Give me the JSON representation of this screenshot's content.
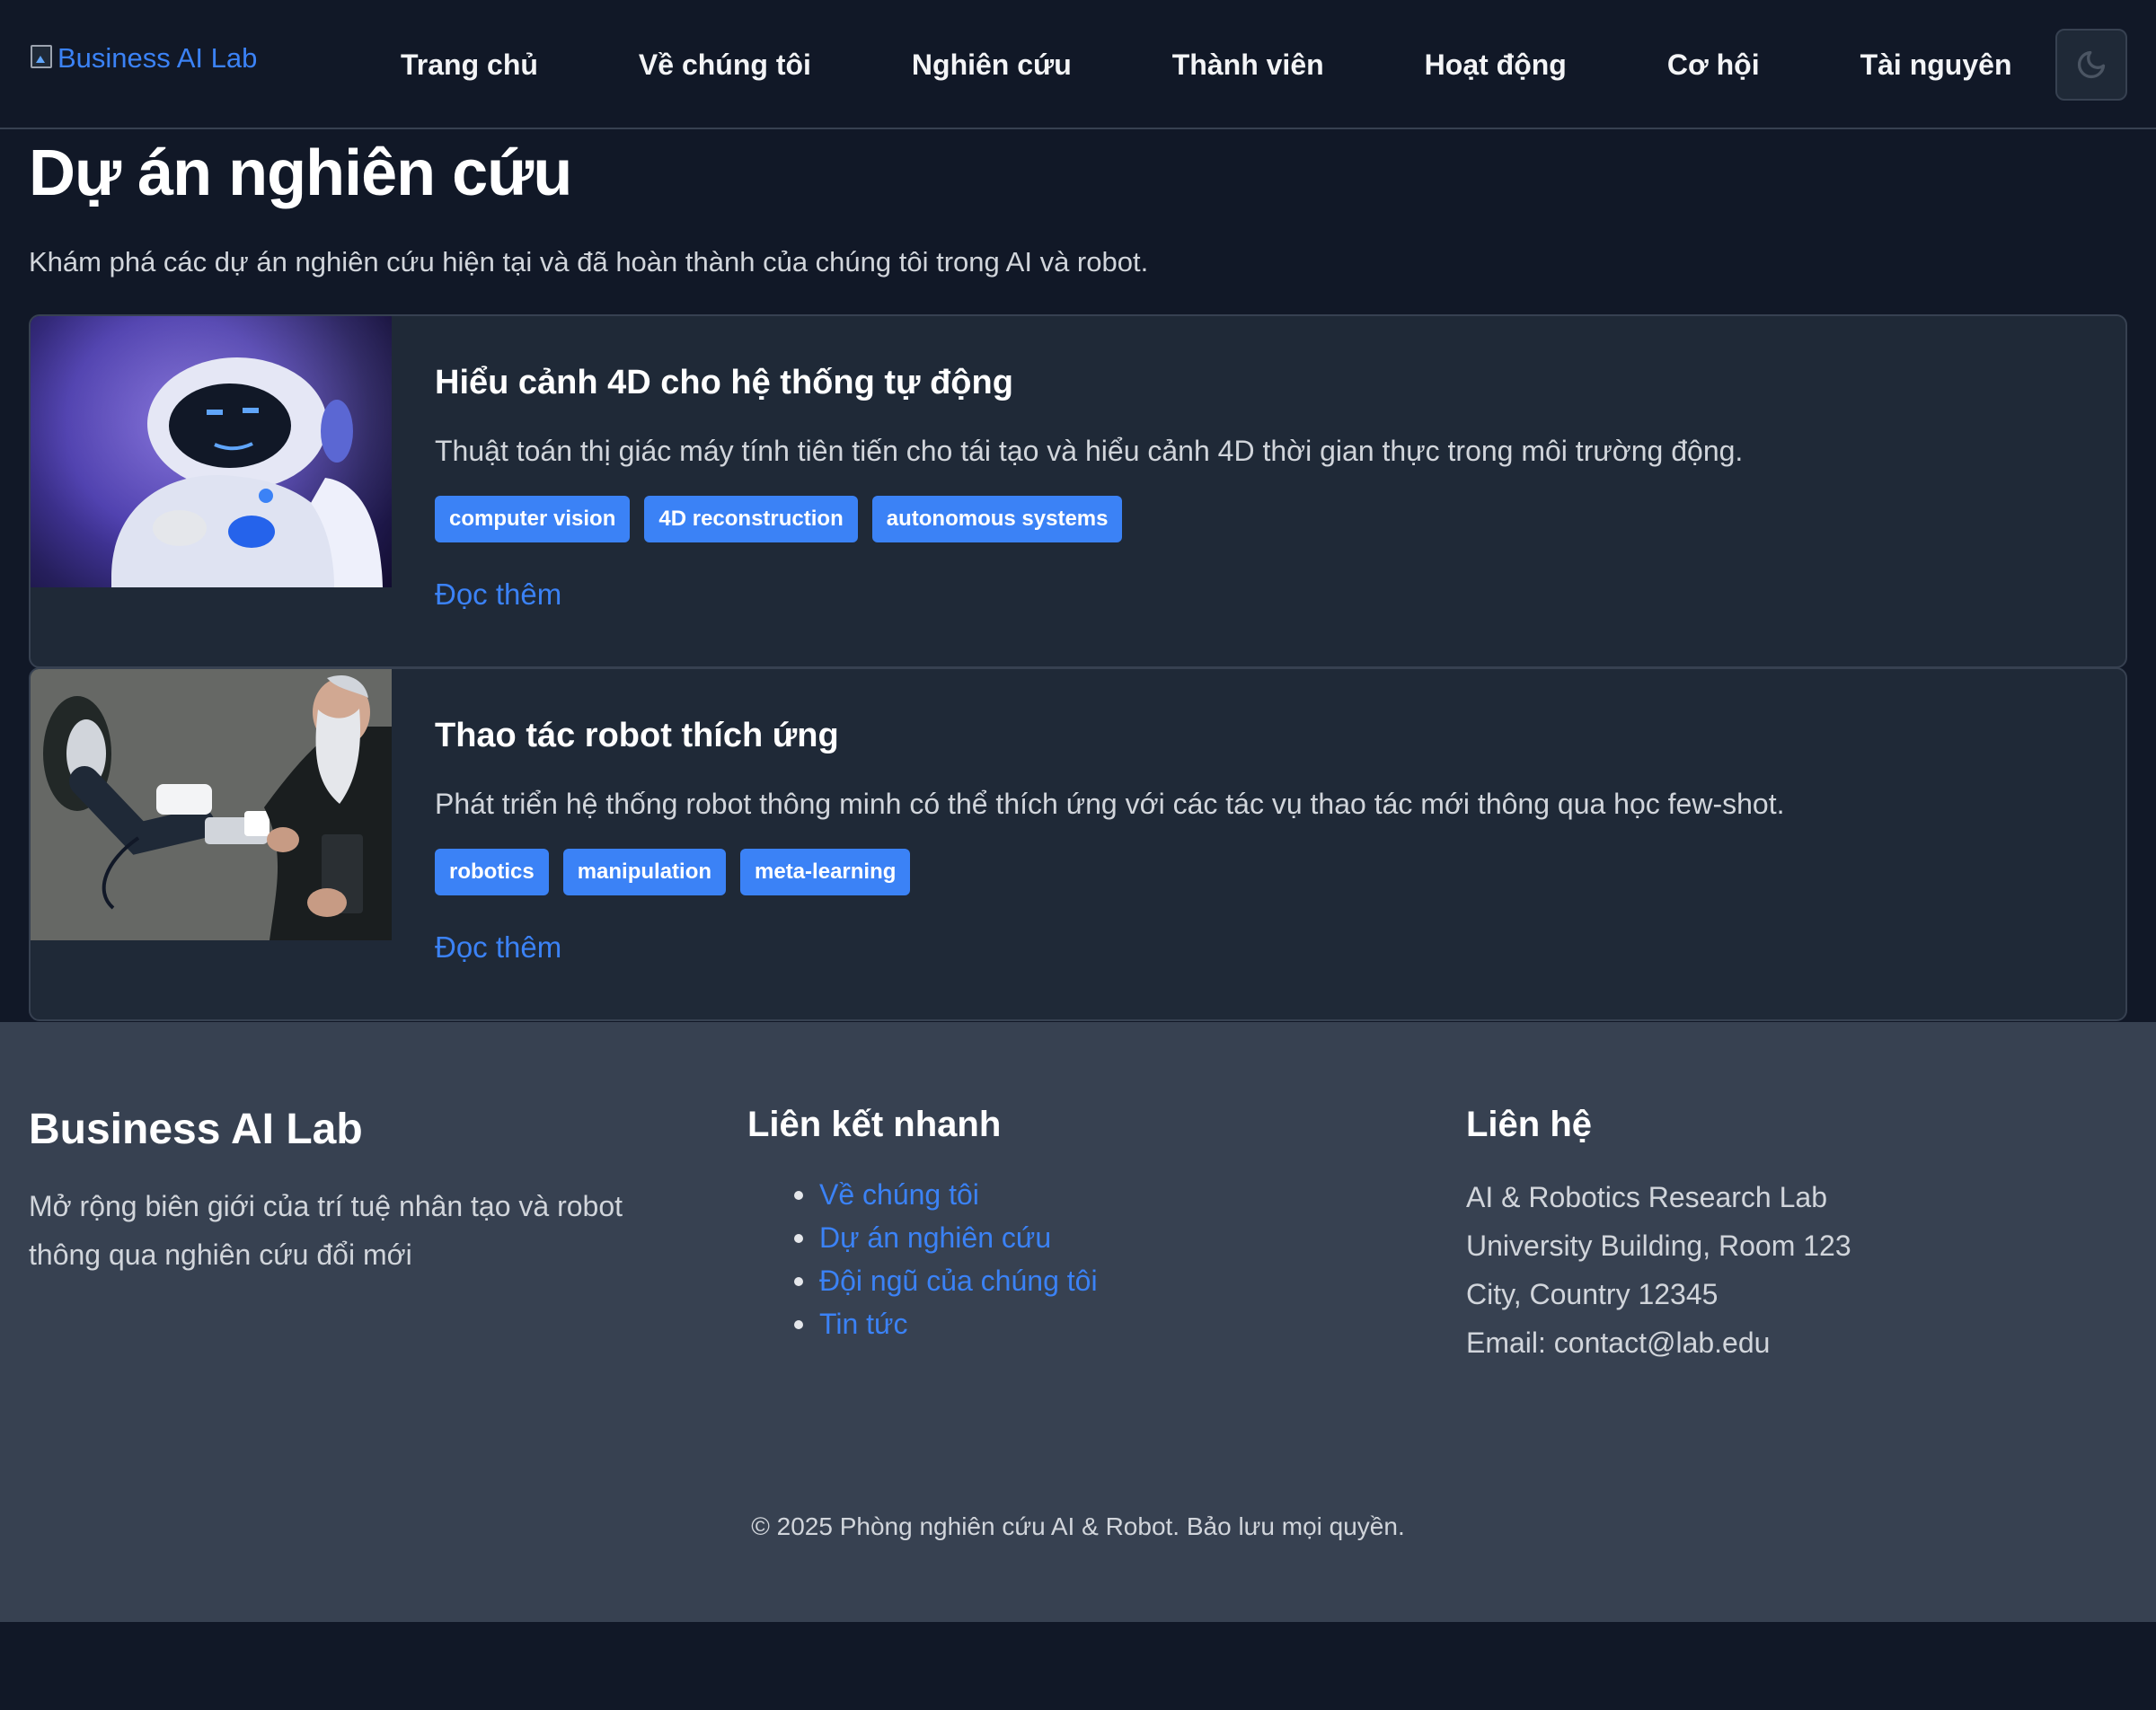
{
  "navbar": {
    "brand_alt": "Business AI Lab",
    "links": [
      {
        "label": "Trang chủ"
      },
      {
        "label": "Về chúng tôi"
      },
      {
        "label": "Nghiên cứu"
      },
      {
        "label": "Thành viên"
      },
      {
        "label": "Hoạt động"
      },
      {
        "label": "Cơ hội"
      },
      {
        "label": "Tài nguyên"
      }
    ],
    "theme_icon": "moon-icon"
  },
  "page": {
    "title": "Dự án nghiên cứu",
    "subtitle": "Khám phá các dự án nghiên cứu hiện tại và đã hoàn thành của chúng tôi trong AI và robot."
  },
  "projects": [
    {
      "title": "Hiểu cảnh 4D cho hệ thống tự động",
      "description": "Thuật toán thị giác máy tính tiên tiến cho tái tạo và hiểu cảnh 4D thời gian thực trong môi trường động.",
      "tags": [
        "computer vision",
        "4D reconstruction",
        "autonomous systems"
      ],
      "read_more": "Đọc thêm",
      "image_alt": "robot-image"
    },
    {
      "title": "Thao tác robot thích ứng",
      "description": "Phát triển hệ thống robot thông minh có thể thích ứng với các tác vụ thao tác mới thông qua học few-shot.",
      "tags": [
        "robotics",
        "manipulation",
        "meta-learning"
      ],
      "read_more": "Đọc thêm",
      "image_alt": "robot-arm-image"
    }
  ],
  "footer": {
    "brand": "Business AI Lab",
    "description": "Mở rộng biên giới của trí tuệ nhân tạo và robot thông qua nghiên cứu đổi mới",
    "quick_links_heading": "Liên kết nhanh",
    "quick_links": [
      "Về chúng tôi",
      "Dự án nghiên cứu",
      "Đội ngũ của chúng tôi",
      "Tin tức"
    ],
    "contact_heading": "Liên hệ",
    "contact": [
      "AI & Robotics Research Lab",
      "University Building, Room 123",
      "City, Country 12345",
      "Email: contact@lab.edu"
    ],
    "copyright": "© 2025 Phòng nghiên cứu AI & Robot. Bảo lưu mọi quyền."
  },
  "colors": {
    "page_background": "#111827",
    "card_background": "#1f2937",
    "footer_background": "#374151",
    "accent": "#3b82f6",
    "text": "#d1d5db"
  }
}
